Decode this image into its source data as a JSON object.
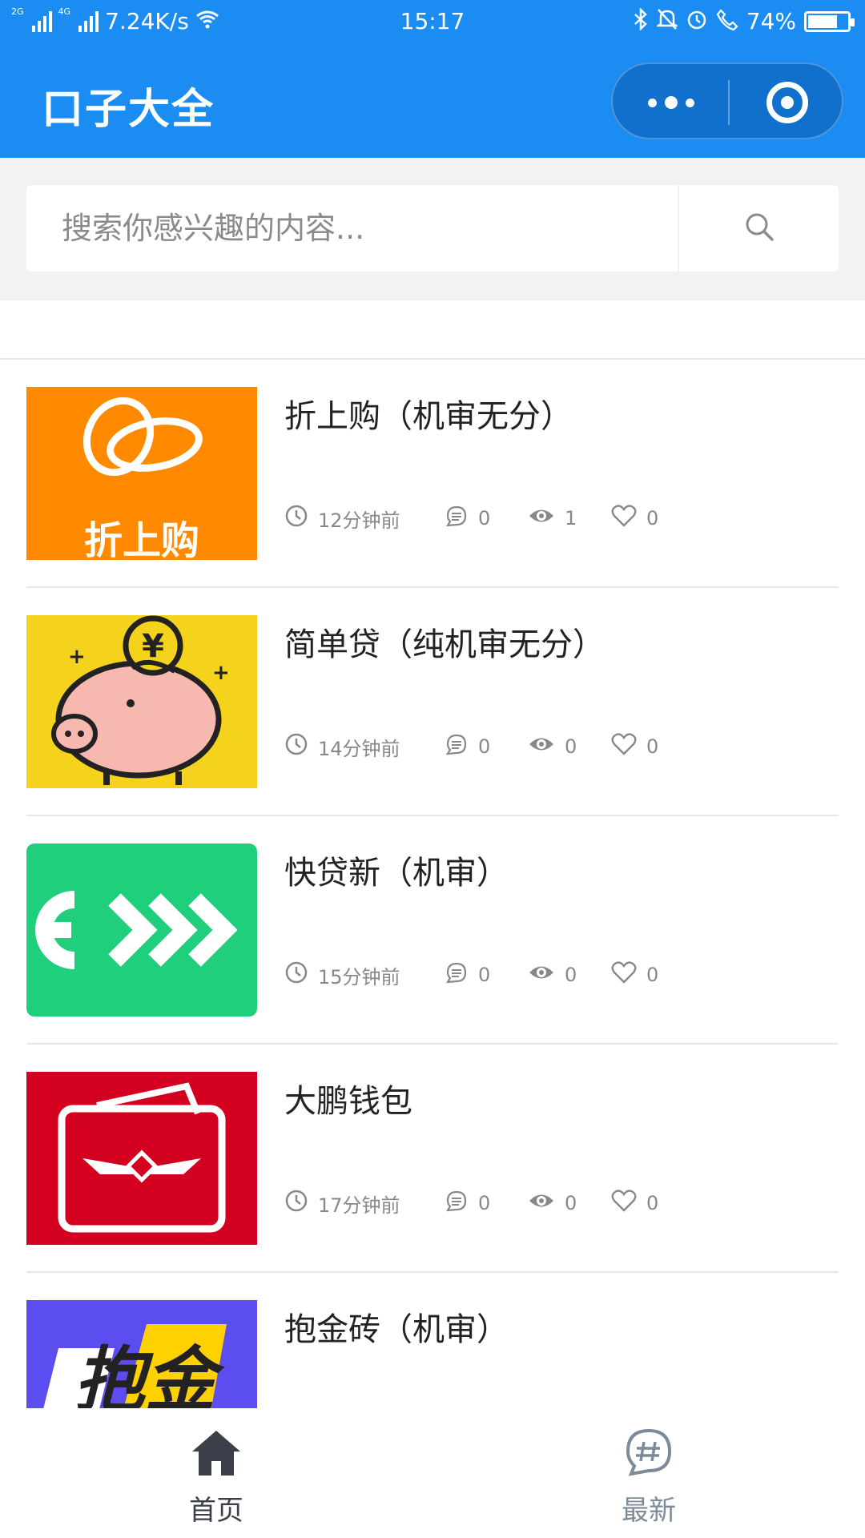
{
  "status_bar": {
    "network_left": "2G",
    "network_right": "4G",
    "speed": "7.24K/s",
    "time": "15:17",
    "battery": "74%",
    "battery_level": 0.74
  },
  "nav": {
    "title": "口子大全"
  },
  "search": {
    "placeholder": "搜索你感兴趣的内容..."
  },
  "items": [
    {
      "title": "折上购（机审无分）",
      "time": "12分钟前",
      "comments": "0",
      "views": "1",
      "likes": "0",
      "thumb_text": "折上购",
      "thumb_color": "#ff8a00"
    },
    {
      "title": "简单贷（纯机审无分）",
      "time": "14分钟前",
      "comments": "0",
      "views": "0",
      "likes": "0",
      "thumb_text": "",
      "thumb_color": "#f5d21b"
    },
    {
      "title": "快贷新（机审）",
      "time": "15分钟前",
      "comments": "0",
      "views": "0",
      "likes": "0",
      "thumb_text": "",
      "thumb_color": "#1fcf7c"
    },
    {
      "title": "大鹏钱包",
      "time": "17分钟前",
      "comments": "0",
      "views": "0",
      "likes": "0",
      "thumb_text": "",
      "thumb_color": "#d4001f"
    },
    {
      "title": "抱金砖（机审）",
      "time": "",
      "comments": "",
      "views": "",
      "likes": "",
      "thumb_text": "抱金",
      "thumb_color": "#5b4df0"
    }
  ],
  "tabbar": {
    "home_label": "首页",
    "new_label": "最新"
  },
  "colors": {
    "primary": "#1a8cf2",
    "tab_active": "#3a3f4a",
    "tab_inactive": "#7c8a99"
  }
}
